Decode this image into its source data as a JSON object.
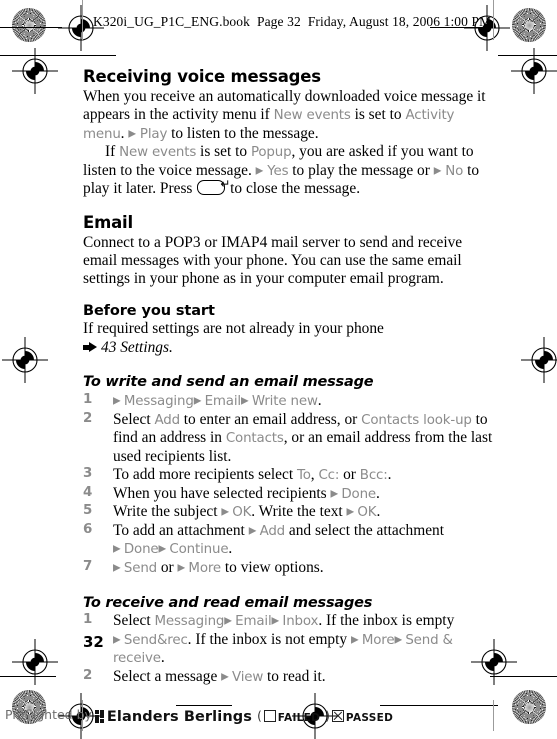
{
  "running_header": {
    "filename": "K320i_UG_P1C_ENG.book",
    "page_label": "Page 32",
    "date": "Friday, August 18, 2006 1:00 PM"
  },
  "folio": "32",
  "sections": {
    "voice": {
      "heading": "Receiving voice messages",
      "p1": {
        "t1": "When you receive an automatically downloaded voice message it appears in the activity menu if ",
        "ui1": "New events",
        "t2": " is set to ",
        "ui2": "Activity menu",
        "t3": ". ",
        "arrow1": "▶",
        "ui3": "Play",
        "t4": " to listen to the message."
      },
      "p2": {
        "t1": "If ",
        "ui1": "New events",
        "t2": " is set to ",
        "ui2": "Popup",
        "t3": ", you are asked if you want to listen to the voice message. ",
        "arrow1": "▶",
        "ui3": "Yes",
        "t4": " to play the message or ",
        "arrow2": "▶",
        "ui4": "No",
        "t5": " to play it later. Press ",
        "keycap_name": "back-key",
        "keycap_glyph": "↵",
        "t6": " to close the message."
      }
    },
    "email": {
      "heading": "Email",
      "intro": "Connect to a POP3 or IMAP4 mail server to send and receive email messages with your phone. You can use the same email settings in your phone as in your computer email program."
    },
    "before_you_start": {
      "heading": "Before you start",
      "line": "If required settings are not already in your phone",
      "reference": "43 Settings."
    },
    "write_send": {
      "heading": "To write and send an email message",
      "steps": [
        {
          "num": "1",
          "parts": [
            {
              "type": "arrow",
              "text": "▶"
            },
            {
              "type": "ui",
              "text": "Messaging"
            },
            {
              "type": "arrow",
              "text": "▶"
            },
            {
              "type": "ui",
              "text": "Email"
            },
            {
              "type": "arrow",
              "text": "▶"
            },
            {
              "type": "ui",
              "text": "Write new"
            },
            {
              "type": "text",
              "text": "."
            }
          ]
        },
        {
          "num": "2",
          "parts": [
            {
              "type": "text",
              "text": "Select "
            },
            {
              "type": "ui",
              "text": "Add"
            },
            {
              "type": "text",
              "text": " to enter an email address, or "
            },
            {
              "type": "ui",
              "text": "Contacts look-up"
            },
            {
              "type": "text",
              "text": " to find an address in "
            },
            {
              "type": "ui",
              "text": "Contacts"
            },
            {
              "type": "text",
              "text": ", or an email address from the last used recipients list."
            }
          ]
        },
        {
          "num": "3",
          "parts": [
            {
              "type": "text",
              "text": "To add more recipients select "
            },
            {
              "type": "ui",
              "text": "To"
            },
            {
              "type": "text",
              "text": ", "
            },
            {
              "type": "ui",
              "text": "Cc:"
            },
            {
              "type": "text",
              "text": " or "
            },
            {
              "type": "ui",
              "text": "Bcc:"
            },
            {
              "type": "text",
              "text": "."
            }
          ]
        },
        {
          "num": "4",
          "parts": [
            {
              "type": "text",
              "text": "When you have selected recipients "
            },
            {
              "type": "arrow",
              "text": "▶"
            },
            {
              "type": "ui",
              "text": "Done"
            },
            {
              "type": "text",
              "text": "."
            }
          ]
        },
        {
          "num": "5",
          "parts": [
            {
              "type": "text",
              "text": "Write the subject "
            },
            {
              "type": "arrow",
              "text": "▶"
            },
            {
              "type": "ui",
              "text": "OK"
            },
            {
              "type": "text",
              "text": ". Write the text "
            },
            {
              "type": "arrow",
              "text": "▶"
            },
            {
              "type": "ui",
              "text": "OK"
            },
            {
              "type": "text",
              "text": "."
            }
          ]
        },
        {
          "num": "6",
          "parts": [
            {
              "type": "text",
              "text": "To add an attachment "
            },
            {
              "type": "arrow",
              "text": "▶"
            },
            {
              "type": "ui",
              "text": "Add"
            },
            {
              "type": "text",
              "text": " and select the attachment "
            },
            {
              "type": "arrow",
              "text": "▶"
            },
            {
              "type": "ui",
              "text": "Done"
            },
            {
              "type": "arrow",
              "text": "▶"
            },
            {
              "type": "ui",
              "text": "Continue"
            },
            {
              "type": "text",
              "text": "."
            }
          ]
        },
        {
          "num": "7",
          "parts": [
            {
              "type": "arrow",
              "text": "▶"
            },
            {
              "type": "ui",
              "text": "Send"
            },
            {
              "type": "text",
              "text": " or "
            },
            {
              "type": "arrow",
              "text": "▶"
            },
            {
              "type": "ui",
              "text": "More"
            },
            {
              "type": "text",
              "text": " to view options."
            }
          ]
        }
      ]
    },
    "receive_read": {
      "heading": "To receive and read email messages",
      "steps": [
        {
          "num": "1",
          "parts": [
            {
              "type": "text",
              "text": "Select "
            },
            {
              "type": "ui",
              "text": "Messaging"
            },
            {
              "type": "arrow",
              "text": "▶"
            },
            {
              "type": "ui",
              "text": "Email"
            },
            {
              "type": "arrow",
              "text": "▶"
            },
            {
              "type": "ui",
              "text": "Inbox"
            },
            {
              "type": "text",
              "text": ". If the inbox is empty "
            },
            {
              "type": "arrow",
              "text": "▶"
            },
            {
              "type": "ui",
              "text": "Send&rec"
            },
            {
              "type": "text",
              "text": ". If the inbox is not empty "
            },
            {
              "type": "arrow",
              "text": "▶"
            },
            {
              "type": "ui",
              "text": "More"
            },
            {
              "type": "arrow",
              "text": "▶"
            },
            {
              "type": "ui",
              "text": "Send & receive"
            },
            {
              "type": "text",
              "text": "."
            }
          ]
        },
        {
          "num": "2",
          "parts": [
            {
              "type": "text",
              "text": "Select a message "
            },
            {
              "type": "arrow",
              "text": "▶"
            },
            {
              "type": "ui",
              "text": "View"
            },
            {
              "type": "text",
              "text": " to read it."
            }
          ]
        }
      ]
    }
  },
  "preflight": {
    "label": "Preflighted by",
    "company": "Elanders Berlings",
    "paren_open": "(",
    "failed": "FAILED",
    "paren_close": ")",
    "passed": "PASSED"
  },
  "colors": {
    "ui_term_gray": "#8b8b8b",
    "body_black": "#000000",
    "page_white": "#ffffff"
  }
}
